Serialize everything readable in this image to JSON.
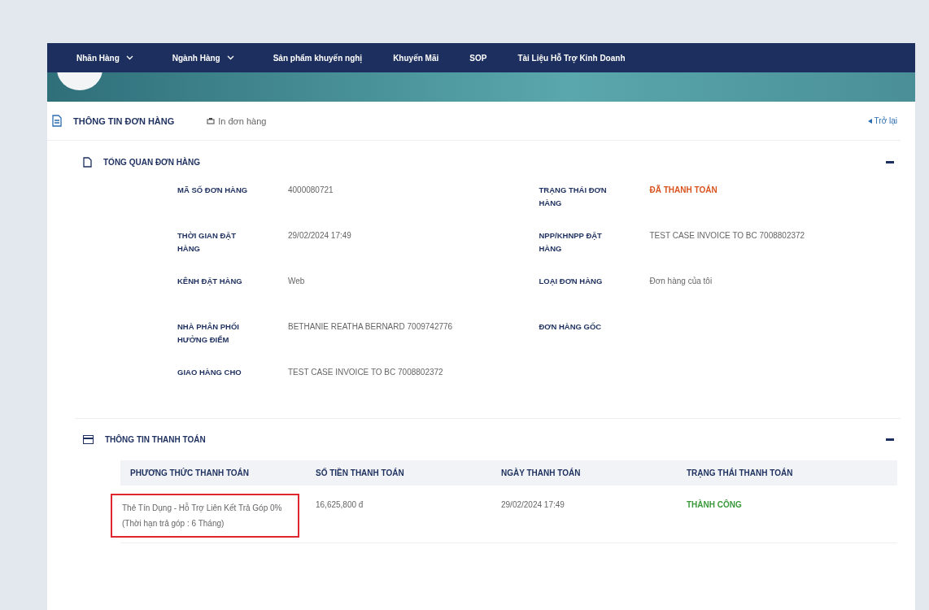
{
  "nav": [
    {
      "label": "Nhãn Hàng",
      "dropdown": true
    },
    {
      "label": "Ngành Hàng",
      "dropdown": true
    },
    {
      "label": "Sản phẩm khuyến nghị",
      "dropdown": false
    },
    {
      "label": "Khuyến Mãi",
      "dropdown": false
    },
    {
      "label": "SOP",
      "dropdown": false
    },
    {
      "label": "Tài Liệu Hỗ Trợ Kinh Doanh",
      "dropdown": false
    }
  ],
  "page": {
    "title": "THÔNG TIN ĐƠN HÀNG",
    "print": "In đơn hàng",
    "back": "Trở lại"
  },
  "overview": {
    "title": "TỔNG QUAN ĐƠN HÀNG",
    "expanded": true,
    "left": [
      {
        "label": "MÃ SỐ ĐƠN HÀNG",
        "value": "4000080721"
      },
      {
        "label": "THỜI GIAN ĐẶT HÀNG",
        "value": "29/02/2024 17:49"
      },
      {
        "label": "KÊNH ĐẶT HÀNG",
        "value": "Web"
      },
      {
        "label": "NHÀ PHÂN PHỐI HƯỞNG ĐIỂM",
        "value": "BETHANIE REATHA BERNARD 7009742776"
      },
      {
        "label": "GIAO HÀNG CHO",
        "value": "TEST CASE INVOICE TO BC 7008802372"
      }
    ],
    "right": [
      {
        "label": "TRẠNG THÁI ĐƠN HÀNG",
        "value": "ĐÃ THANH TOÁN",
        "kind": "status"
      },
      {
        "label": "NPP/KHNPP ĐẶT HÀNG",
        "value": "TEST CASE INVOICE TO BC 7008802372",
        "kind": "plain"
      },
      {
        "label": "LOẠI ĐƠN HÀNG",
        "value": "Đơn hàng của tôi",
        "kind": "plain"
      },
      {
        "label": "ĐƠN HÀNG GỐC",
        "kind": "plain"
      }
    ]
  },
  "payment": {
    "title": "THÔNG TIN THANH TOÁN",
    "expanded": true,
    "columns": [
      "PHƯƠNG THỨC THANH TOÁN",
      "SỐ TIỀN THANH TOÁN",
      "NGÀY THANH TOÁN",
      "TRẠNG THÁI THANH TOÁN"
    ],
    "rows": [
      {
        "method": [
          "Thẻ Tín Dụng - Hỗ Trợ Liên Kết Trả Góp 0%",
          "(Thời hạn trả góp : 6 Tháng)"
        ],
        "highlighted": true,
        "amount": "16,625,800 đ",
        "date": "29/02/2024 17:49",
        "status": "THÀNH CÔNG"
      }
    ]
  }
}
